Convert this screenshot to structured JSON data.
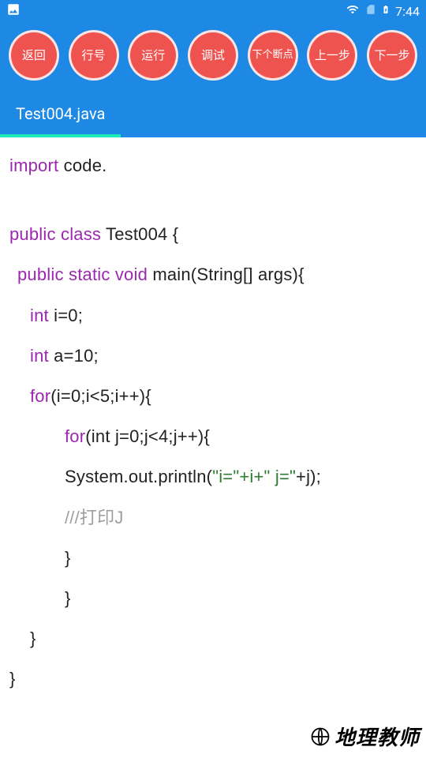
{
  "statusbar": {
    "time": "7:44"
  },
  "toolbar": {
    "buttons": [
      {
        "id": "back",
        "label": "返回"
      },
      {
        "id": "line-number",
        "label": "行号"
      },
      {
        "id": "run",
        "label": "运行"
      },
      {
        "id": "debug",
        "label": "调试"
      },
      {
        "id": "next-breakpoint",
        "label": "下个断点"
      },
      {
        "id": "step-back",
        "label": "上一步"
      },
      {
        "id": "step-forward",
        "label": "下一步"
      }
    ]
  },
  "tab": {
    "filename": "Test004.java"
  },
  "code": {
    "l0_kw": "import",
    "l0_rest": " code.",
    "l1_kw": "public class",
    "l1_rest": " Test004 {",
    "l2_kw": "public static void",
    "l2_rest": " main(String[] args){",
    "l3_kw": "int",
    "l3_rest": " i=0;",
    "l4_kw": "int",
    "l4_rest": " a=10;",
    "l5_kw": "for",
    "l5_rest": "(i=0;i<5;i++){",
    "l6_kw": "for",
    "l6_rest": "(int j=0;j<4;j++){",
    "l7_a": "System.out.println(",
    "l7_str": "\"i=\"+i+\" j=\"",
    "l7_b": "+j);",
    "l8_comment": "///打印J",
    "l9": "}",
    "l10": "}",
    "l11": "}",
    "l12": "}"
  },
  "watermark": {
    "text": "地理教师"
  }
}
